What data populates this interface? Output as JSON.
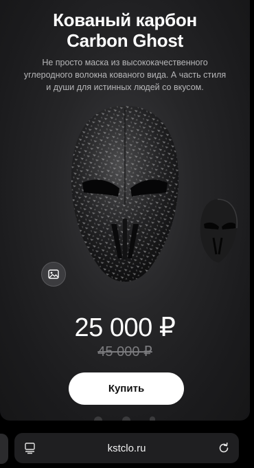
{
  "product": {
    "title_line1": "Кованый карбон",
    "title_line2": "Carbon Ghost",
    "description": "Не просто маска из высококачественного углеродного волокна кованого вида. А часть стиля и души для истинных людей со вкусом.",
    "price": "25 000 ₽",
    "old_price": "45 000 ₽",
    "buy_label": "Купить"
  },
  "icons": {
    "gallery": "image-icon",
    "tabs": "tabs-icon",
    "reload": "reload-icon"
  },
  "browser": {
    "url": "kstclo.ru"
  },
  "colors": {
    "card_bg": "#262628",
    "button_bg": "#ffffff",
    "button_text": "#111111",
    "old_price": "#7c7c7f"
  }
}
